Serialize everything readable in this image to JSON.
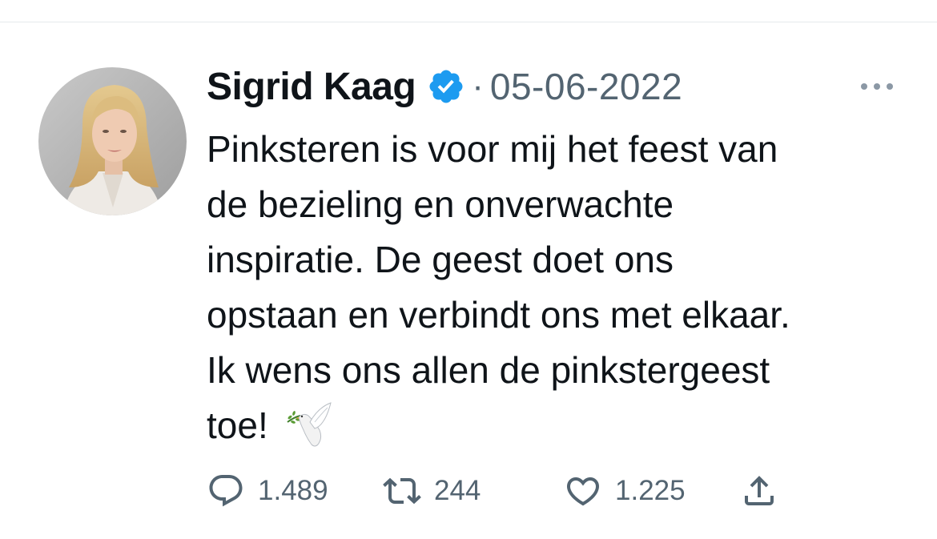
{
  "tweet": {
    "author_name": "Sigrid Kaag",
    "separator": "·",
    "date": "05-06-2022",
    "text_lines": [
      "Pinksteren is voor mij het feest van",
      "de bezieling en onverwachte",
      "inspiratie. De geest doet ons",
      "opstaan en verbindt ons met elkaar.",
      "Ik wens ons allen de pinkstergeest",
      "toe!"
    ],
    "emoji": "dove-with-olive-branch"
  },
  "actions": {
    "replies": "1.489",
    "retweets": "244",
    "likes": "1.225"
  },
  "icons": {
    "verified": "verified-badge-icon",
    "more": "more-dots-icon",
    "reply": "reply-icon",
    "retweet": "retweet-icon",
    "like": "heart-icon",
    "share": "share-icon"
  },
  "colors": {
    "text": "#0f1419",
    "secondary": "#536471",
    "verified_blue": "#1d9bf0",
    "divider": "#e6e9ec"
  }
}
